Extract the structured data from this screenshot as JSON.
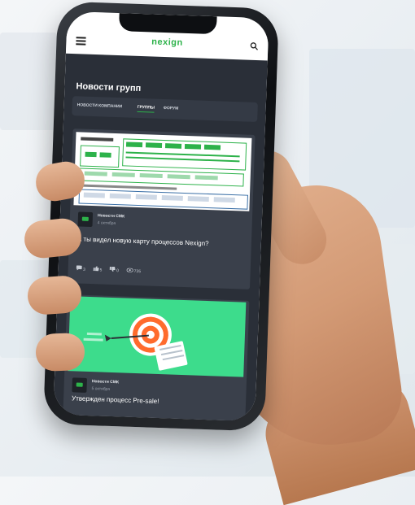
{
  "app": {
    "logo": "nexign",
    "page_title": "Новости групп"
  },
  "tabs": [
    {
      "label": "НОВОСТИ КОМПАНИИ",
      "active": false
    },
    {
      "label": "ГРУППЫ",
      "active": true
    },
    {
      "label": "ФОРУМ",
      "active": false
    }
  ],
  "cards": [
    {
      "source": "Новости СМК",
      "date": "4 октября",
      "text": "А ты видел новую карту процессов Nexign?",
      "stats": {
        "comments": "3",
        "likes": "5",
        "dislikes": "0",
        "views": "735"
      }
    },
    {
      "source": "Новости СМК",
      "date": "5 октября",
      "text": "Утвержден процесс Pre-sale!"
    }
  ],
  "colors": {
    "brand_green": "#2db24a",
    "card_bg": "#3a404b",
    "screen_bg": "#2a2f38",
    "illustration_bg": "#3ddc8c"
  },
  "icons": [
    "menu-icon",
    "search-icon",
    "comment-icon",
    "like-icon",
    "dislike-icon",
    "views-icon",
    "target-icon"
  ]
}
